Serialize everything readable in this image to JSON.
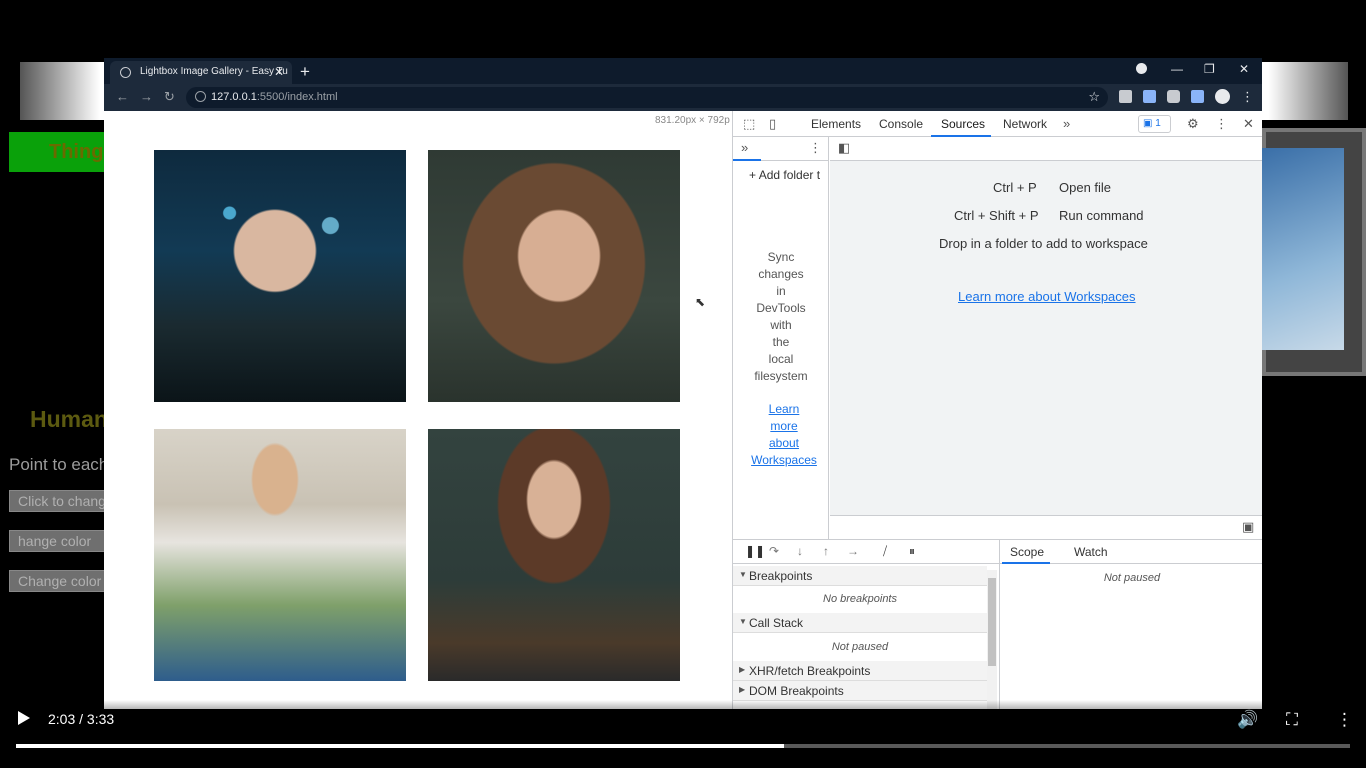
{
  "background": {
    "green_label": "Thing",
    "human_label": "Human",
    "point_label": "Point to each",
    "buttons": [
      "Click to chang",
      "hange color",
      "Change color"
    ]
  },
  "browser": {
    "tab_title": "Lightbox Image Gallery - Easy Tu",
    "url_host": "127.0.0.1",
    "url_rest": ":5500/index.html"
  },
  "page": {
    "dimensions": "831.20px × 792p"
  },
  "devtools": {
    "tabs": [
      "Elements",
      "Console",
      "Sources",
      "Network"
    ],
    "active_tab": "Sources",
    "message_count": "1",
    "add_folder": "Add folder t",
    "sync_text": [
      "Sync",
      "changes",
      "in",
      "DevTools",
      "with",
      "the",
      "local",
      "filesystem"
    ],
    "learn_left": [
      "Learn",
      "more",
      "about",
      "Workspaces"
    ],
    "shortcuts": [
      {
        "keys": "Ctrl + P",
        "action": "Open file"
      },
      {
        "keys": "Ctrl + Shift + P",
        "action": "Run command"
      }
    ],
    "drop_text": "Drop in a folder to add to workspace",
    "learn_link": "Learn more about Workspaces",
    "sections": [
      {
        "title": "Breakpoints",
        "expanded": true,
        "empty": "No breakpoints"
      },
      {
        "title": "Call Stack",
        "expanded": true,
        "empty": "Not paused"
      },
      {
        "title": "XHR/fetch Breakpoints",
        "expanded": false
      },
      {
        "title": "DOM Breakpoints",
        "expanded": false
      }
    ],
    "scope_tabs": [
      "Scope",
      "Watch"
    ],
    "scope_empty": "Not paused"
  },
  "player": {
    "time": "2:03 / 3:33",
    "progress": 0.576
  }
}
